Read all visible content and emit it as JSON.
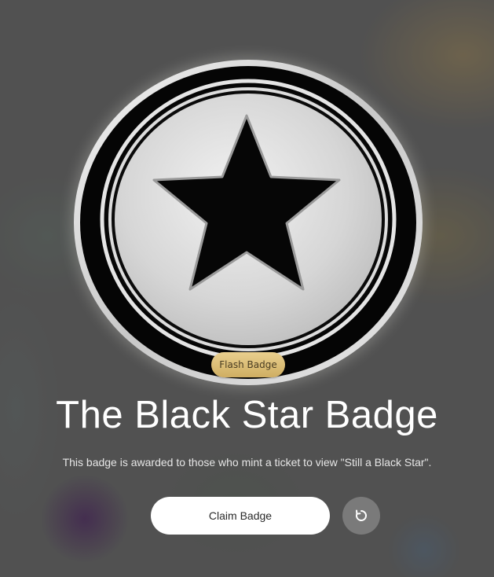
{
  "badge": {
    "tag_label": "Flash Badge",
    "icon": "star-icon"
  },
  "title": "The Black Star Badge",
  "description": "This badge is awarded to those who mint a ticket to view \"Still a Black Star\".",
  "actions": {
    "claim_label": "Claim Badge",
    "reset_icon": "refresh-icon"
  },
  "colors": {
    "tag_gold": "#d9bb72",
    "button_bg": "#ffffff",
    "reset_bg": "#7a7a7a"
  }
}
